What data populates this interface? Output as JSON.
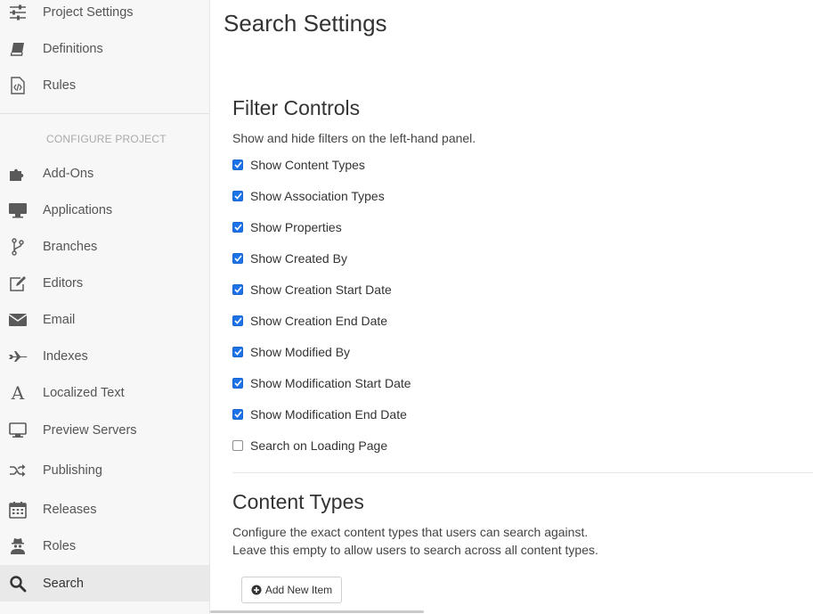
{
  "sidebar": {
    "top_items": [
      {
        "label": "Project Settings",
        "icon": "sliders-icon"
      },
      {
        "label": "Definitions",
        "icon": "book-icon"
      },
      {
        "label": "Rules",
        "icon": "code-file-icon"
      }
    ],
    "section_header": "CONFIGURE PROJECT",
    "items": [
      {
        "label": "Add-Ons",
        "icon": "puzzle-icon"
      },
      {
        "label": "Applications",
        "icon": "monitor-icon"
      },
      {
        "label": "Branches",
        "icon": "branch-icon"
      },
      {
        "label": "Editors",
        "icon": "edit-icon"
      },
      {
        "label": "Email",
        "icon": "envelope-icon"
      },
      {
        "label": "Indexes",
        "icon": "plane-icon"
      },
      {
        "label": "Localized Text",
        "icon": "font-icon"
      },
      {
        "label": "Preview Servers",
        "icon": "desktop-icon"
      },
      {
        "label": "Publishing",
        "icon": "shuffle-icon"
      },
      {
        "label": "Releases",
        "icon": "calendar-icon"
      },
      {
        "label": "Roles",
        "icon": "user-secret-icon"
      },
      {
        "label": "Search",
        "icon": "search-icon",
        "active": true
      }
    ]
  },
  "main": {
    "title": "Search Settings",
    "filter_controls": {
      "heading": "Filter Controls",
      "description": "Show and hide filters on the left-hand panel.",
      "options": [
        {
          "label": "Show Content Types",
          "checked": true
        },
        {
          "label": "Show Association Types",
          "checked": true
        },
        {
          "label": "Show Properties",
          "checked": true
        },
        {
          "label": "Show Created By",
          "checked": true
        },
        {
          "label": "Show Creation Start Date",
          "checked": true
        },
        {
          "label": "Show Creation End Date",
          "checked": true
        },
        {
          "label": "Show Modified By",
          "checked": true
        },
        {
          "label": "Show Modification Start Date",
          "checked": true
        },
        {
          "label": "Show Modification End Date",
          "checked": true
        },
        {
          "label": "Search on Loading Page",
          "checked": false
        }
      ]
    },
    "content_types": {
      "heading": "Content Types",
      "description_line1": "Configure the exact content types that users can search against.",
      "description_line2": "Leave this empty to allow users to search across all content types.",
      "add_button_label": "Add New Item"
    }
  },
  "colors": {
    "checkbox_checked": "#1d72e8",
    "sidebar_bg": "#f7f7f7",
    "sidebar_active_bg": "#e9e9e9"
  }
}
